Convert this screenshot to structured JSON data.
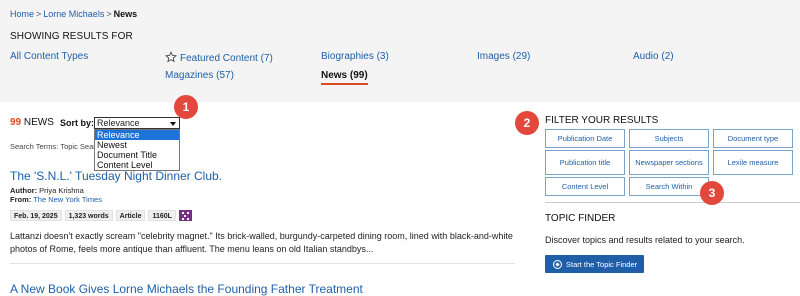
{
  "breadcrumb": {
    "items": [
      "Home",
      "Lorne Michaels",
      "News"
    ],
    "separator": ">"
  },
  "showing_label": "SHOWING RESULTS FOR",
  "content_types": [
    {
      "label": "All Content Types"
    },
    {
      "label": "Featured Content",
      "count": "(7)"
    },
    {
      "label": "Biographies",
      "count": "(3)"
    },
    {
      "label": "Images",
      "count": "(29)"
    },
    {
      "label": "Audio",
      "count": "(2)"
    },
    {
      "label": "Magazines",
      "count": "(57)"
    },
    {
      "label": "News",
      "count": "(99)",
      "active": true
    }
  ],
  "results": {
    "count": "99",
    "count_label": "NEWS",
    "sort_label": "Sort by:",
    "sort_value": "Relevance",
    "sort_options": [
      "Relevance",
      "Newest",
      "Document Title",
      "Content Level"
    ],
    "search_terms_label": "Search Terms:",
    "search_terms_value": "Topic Sear"
  },
  "result1": {
    "title": "The 'S.N.L.' Tuesday Night Dinner Club.",
    "author_label": "Author:",
    "author": "Priya Krishna",
    "from_label": "From:",
    "from": "The New York Times",
    "chips": [
      "Feb. 19, 2025",
      "1,323 words",
      "Article",
      "1160L"
    ],
    "snippet": "Lattanzi doesn't exactly scream \"celebrity magnet.\" Its brick-walled, burgundy-carpeted dining room, lined with black-and-white photos of Rome, feels more antique than affluent. The menu leans on old Italian standbys..."
  },
  "result2": {
    "title": "A New Book Gives Lorne Michaels the Founding Father Treatment"
  },
  "filters": {
    "header": "FILTER YOUR RESULTS",
    "buttons": [
      "Publication Date",
      "Subjects",
      "Document type",
      "Publication title",
      "Newspaper sections",
      "Lexile measure",
      "Content Level",
      "Search Within"
    ]
  },
  "topic_finder": {
    "header": "TOPIC FINDER",
    "description": "Discover topics and results related to your search.",
    "button_label": "Start the Topic Finder"
  },
  "badges": [
    "1",
    "2",
    "3"
  ],
  "colors": {
    "link": "#1f5fa8",
    "accent": "#d94b20",
    "badge": "#e2483c",
    "selected_option": "#1e73d8",
    "lexile_chip": "#7a2f86"
  }
}
